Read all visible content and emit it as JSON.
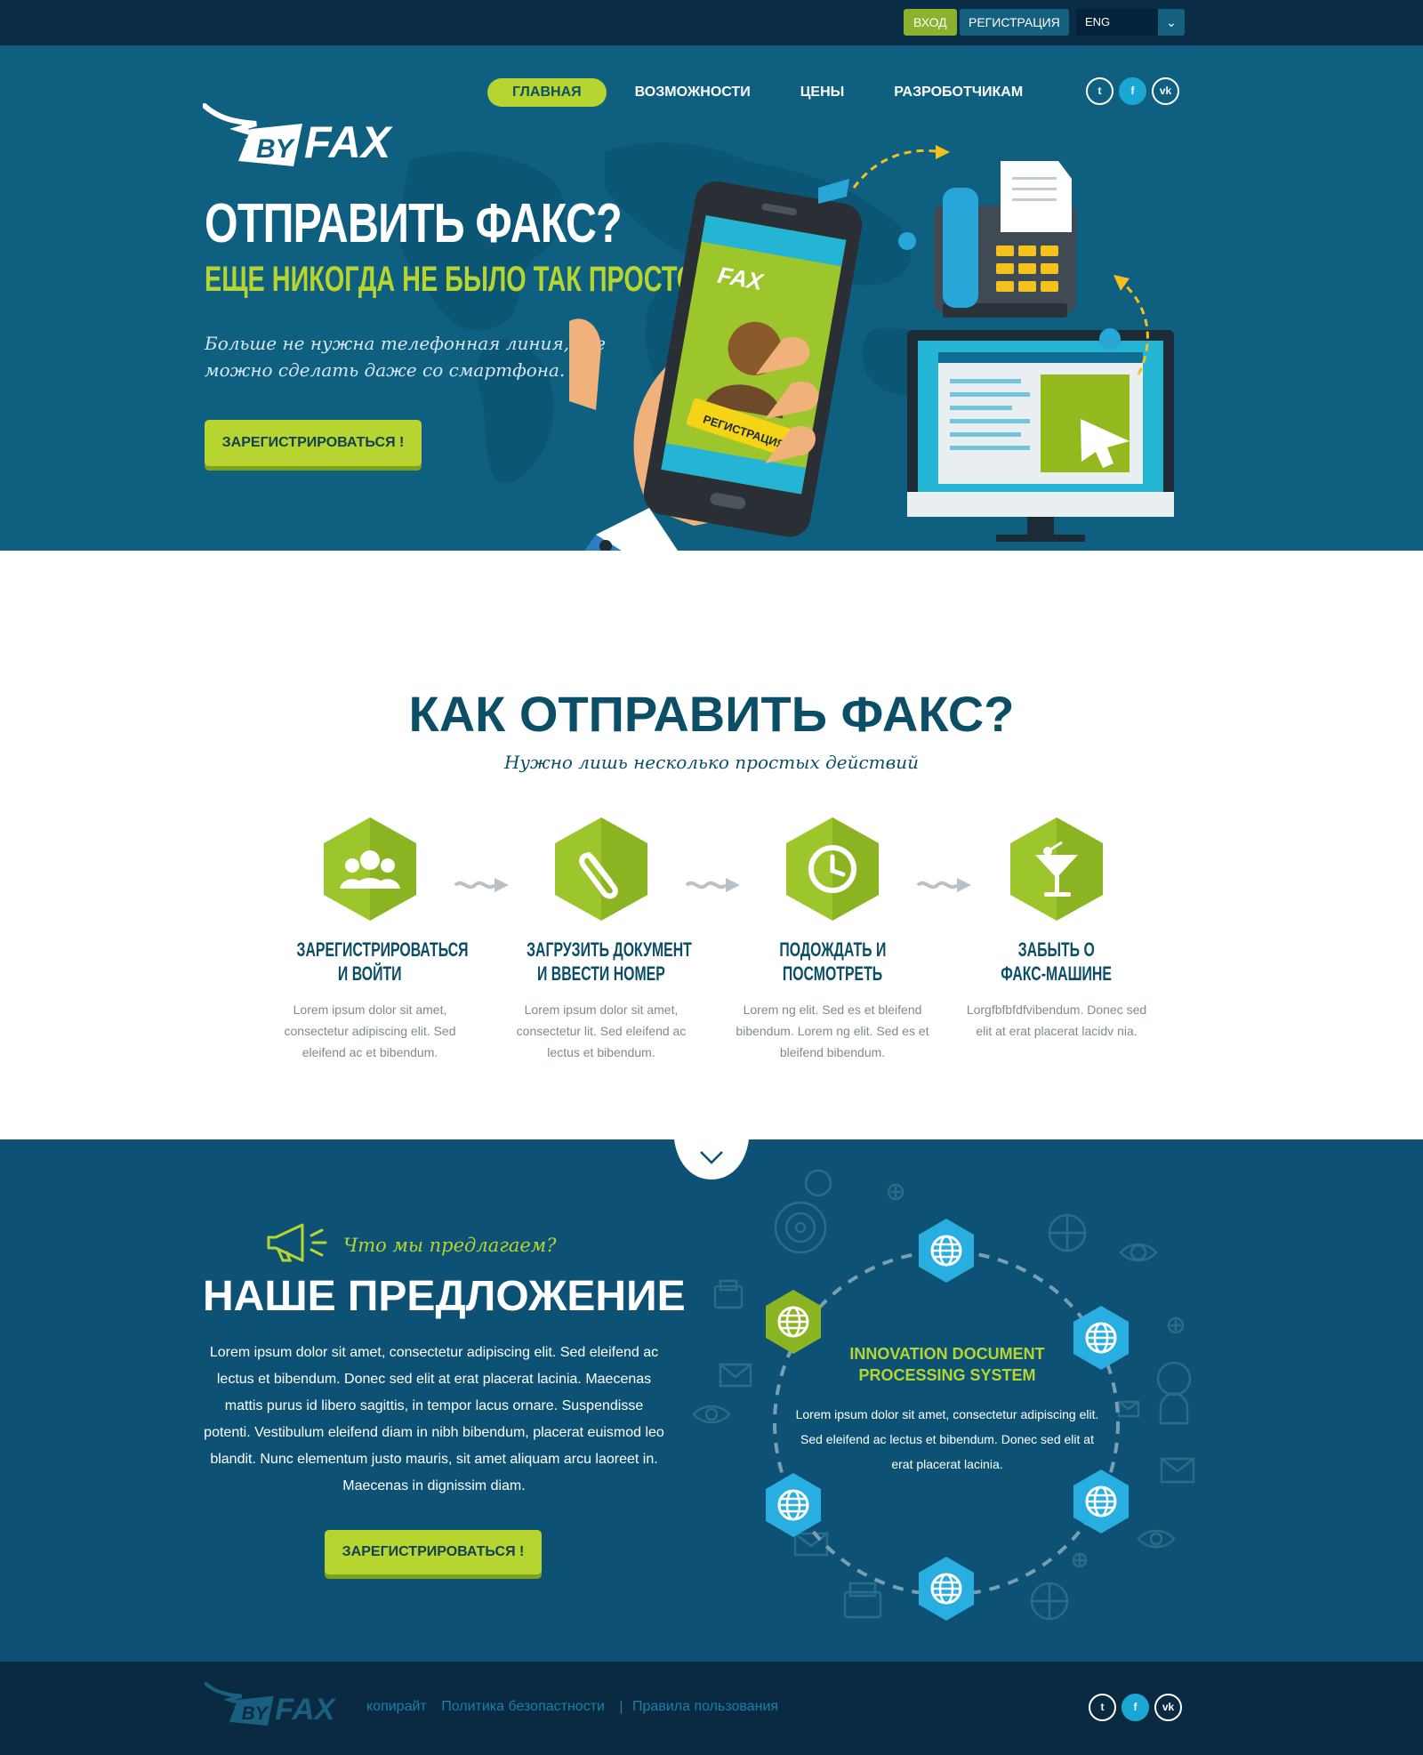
{
  "topbar": {
    "login_label": "ВХОД",
    "register_label": "РЕГИСТРАЦИЯ",
    "language": "ENG"
  },
  "brand": {
    "name_prefix": "BY",
    "name": "FAX"
  },
  "nav": {
    "items": [
      {
        "label": "ГЛАВНАЯ",
        "active": true
      },
      {
        "label": "ВОЗМОЖНОСТИ",
        "active": false
      },
      {
        "label": "ЦЕНЫ",
        "active": false
      },
      {
        "label": "РАЗРОБОТЧИКАМ",
        "active": false
      }
    ]
  },
  "social": [
    "twitter-icon",
    "facebook-icon",
    "vk-icon"
  ],
  "hero": {
    "title": "ОТПРАВИТЬ ФАКС?",
    "subtitle": "ЕЩЕ НИКОГДА НЕ БЫЛО ТАК ПРОСТО!",
    "text": "Больше не нужна телефонная линия, все можно сделать даже со смартфона.",
    "cta": "ЗАРЕГИСТРИРОВАТЬСЯ !",
    "phone_screen_label": "РЕГИСТРАЦИЯ"
  },
  "how": {
    "title": "КАК ОТПРАВИТЬ ФАКС?",
    "subtitle": "Нужно лишь несколько простых действий",
    "steps": [
      {
        "icon": "users-icon",
        "title_line1": "ЗАРЕГИСТРИРОВАТЬСЯ",
        "title_line2": "И ВОЙТИ",
        "desc": "Lorem ipsum dolor sit amet, consectetur adipiscing elit. Sed eleifend ac et bibendum."
      },
      {
        "icon": "paperclip-icon",
        "title_line1": "ЗАГРУЗИТЬ ДОКУМЕНТ",
        "title_line2": "И ВВЕСТИ НОМЕР",
        "desc": "Lorem ipsum dolor sit amet, consectetur lit. Sed eleifend ac lectus et bibendum."
      },
      {
        "icon": "clock-icon",
        "title_line1": "ПОДОЖДАТЬ И",
        "title_line2": "ПОСМОТРЕТЬ",
        "desc": "Lorem ng elit. Sed es et bleifend bibendum. Lorem ng elit. Sed es et bleifend bibendum."
      },
      {
        "icon": "cocktail-icon",
        "title_line1": "ЗАБЫТЬ О",
        "title_line2": "ФАКС-МАШИНЕ",
        "desc": "Lorgfbfbfdfvibendum. Donec sed elit at erat placerat lacidv  nia."
      }
    ]
  },
  "offer": {
    "kicker": "Что мы предлагаем?",
    "title": "НАШЕ ПРЕДЛОЖЕНИЕ",
    "text": "Lorem ipsum dolor sit amet, consectetur adipiscing elit. Sed eleifend ac lectus et bibendum. Donec sed elit at erat placerat lacinia. Maecenas mattis purus id libero sagittis, in tempor lacus ornare. Suspendisse potenti. Vestibulum eleifend diam in nibh bibendum, placerat euismod leo blandit. Nunc elementum justo mauris, sit amet aliquam arcu laoreet in. Maecenas in dignissim diam.",
    "cta": "ЗАРЕГИСТРИРОВАТЬСЯ !",
    "circle_title_line1": "INNOVATION DOCUMENT",
    "circle_title_line2": "PROCESSING SYSTEM",
    "circle_text": "Lorem ipsum dolor sit amet, consectetur adipiscing elit. Sed eleifend ac lectus et bibendum. Donec sed elit at erat placerat lacinia."
  },
  "footer": {
    "link1": "копирайт",
    "link2": "Политика безопастности",
    "separator": "|",
    "link3": "Правила пользования"
  },
  "colors": {
    "navy": "#0b2c45",
    "teal": "#0f5f80",
    "lime": "#b6d530",
    "deep": "#0c4e66",
    "offer_bg": "#0d5275",
    "sky": "#1aa7d4"
  }
}
